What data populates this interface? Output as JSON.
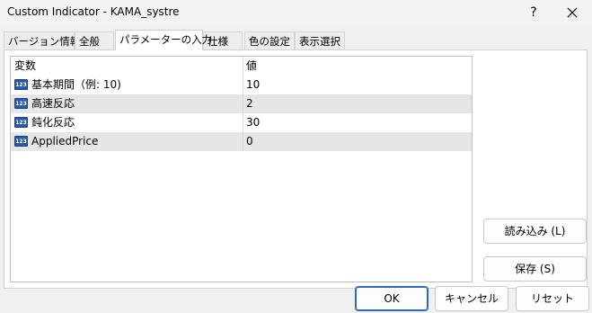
{
  "window": {
    "title": "Custom Indicator - KAMA_systre",
    "help_label": "?"
  },
  "tabs": [
    {
      "label": "バージョン情報"
    },
    {
      "label": "全般"
    },
    {
      "label": "パラメーターの入力",
      "active": true
    },
    {
      "label": "仕様"
    },
    {
      "label": "色の設定"
    },
    {
      "label": "表示選択"
    }
  ],
  "params_table": {
    "columns": [
      "変数",
      "値"
    ],
    "icon": "integer-param-icon",
    "icon_text": "123",
    "rows": [
      {
        "name": "基本期間（例: 10)",
        "value": "10"
      },
      {
        "name": "高速反応",
        "value": "2"
      },
      {
        "name": "鈍化反応",
        "value": "30"
      },
      {
        "name": "AppliedPrice",
        "value": "0"
      }
    ]
  },
  "buttons": {
    "load": "読み込み (L)",
    "save": "保存 (S)",
    "ok": "OK",
    "cancel": "キャンセル",
    "reset": "リセット"
  },
  "colors": {
    "ok_border": "#2d69c7",
    "alt_row": "#e6e6e6",
    "param_icon": "#2a5aa8"
  }
}
